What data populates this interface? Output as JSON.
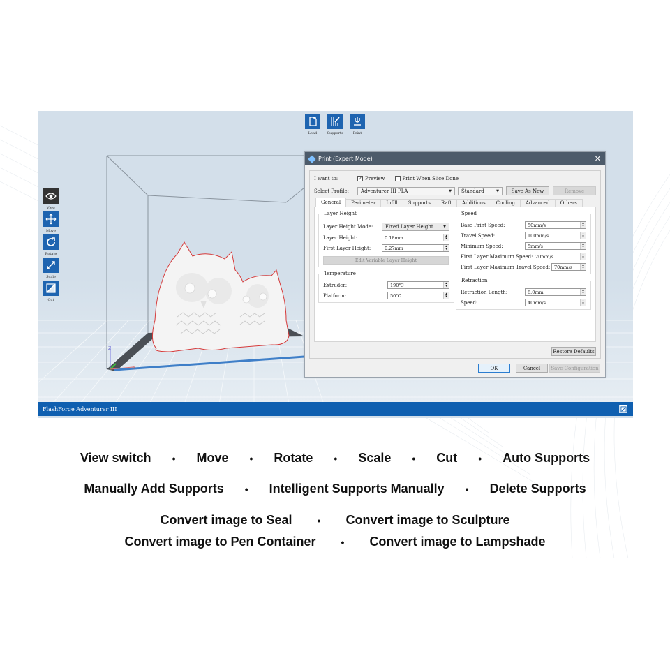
{
  "top_toolbar": [
    {
      "id": "load",
      "label": "Load",
      "icon": "file-add-icon"
    },
    {
      "id": "supports",
      "label": "Supports",
      "icon": "supports-icon"
    },
    {
      "id": "print",
      "label": "Print",
      "icon": "print-icon"
    }
  ],
  "left_toolbar": [
    {
      "id": "view",
      "label": "View",
      "icon": "eye-icon",
      "active": true
    },
    {
      "id": "move",
      "label": "Move",
      "icon": "move-arrows-icon"
    },
    {
      "id": "rotate",
      "label": "Rotate",
      "icon": "rotate-icon"
    },
    {
      "id": "scale",
      "label": "Scale",
      "icon": "scale-arrow-icon"
    },
    {
      "id": "cut",
      "label": "Cut",
      "icon": "cut-icon"
    }
  ],
  "viewport": {
    "axis_labels": {
      "z": "Z",
      "x": "X"
    }
  },
  "statusbar": {
    "text": "FlashForge Adventurer III"
  },
  "dialog": {
    "title": "Print (Expert Mode)",
    "i_want_to_label": "I want to:",
    "preview_label": "Preview",
    "preview_checked": true,
    "print_when_slice_done_label": "Print When Slice Done",
    "print_when_slice_done_checked": false,
    "select_profile_label": "Select Profile:",
    "profile_value": "Adventurer III PLA",
    "quality_value": "Standard",
    "save_as_new_label": "Save As New",
    "remove_label": "Remove",
    "tabs": [
      "General",
      "Perimeter",
      "Infill",
      "Supports",
      "Raft",
      "Additions",
      "Cooling",
      "Advanced",
      "Others"
    ],
    "active_tab": "General",
    "layer_height": {
      "title": "Layer Height",
      "mode_label": "Layer Height Mode:",
      "mode_value": "Fixed Layer Height",
      "layer_height_label": "Layer Height:",
      "layer_height_value": "0.18mm",
      "first_layer_height_label": "First Layer Height:",
      "first_layer_height_value": "0.27mm",
      "edit_variable_label": "Edit Variable Layer Height"
    },
    "temperature": {
      "title": "Temperature",
      "extruder_label": "Extruder:",
      "extruder_value": "190℃",
      "platform_label": "Platform:",
      "platform_value": "50℃"
    },
    "speed": {
      "title": "Speed",
      "base_print_label": "Base Print Speed:",
      "base_print_value": "50mm/s",
      "travel_label": "Travel Speed:",
      "travel_value": "100mm/s",
      "minimum_label": "Minimum Speed:",
      "minimum_value": "5mm/s",
      "first_layer_max_label": "First Layer Maximum Speed:",
      "first_layer_max_value": "20mm/s",
      "first_layer_max_travel_label": "First Layer Maximum Travel Speed:",
      "first_layer_max_travel_value": "70mm/s"
    },
    "retraction": {
      "title": "Retraction",
      "length_label": "Retraction Length:",
      "length_value": "8.0mm",
      "speed_label": "Speed:",
      "speed_value": "40mm/s"
    },
    "restore_defaults_label": "Restore Defaults",
    "ok_label": "OK",
    "cancel_label": "Cancel",
    "save_configuration_label": "Save Configuration"
  },
  "captions": {
    "line1": [
      "View switch",
      "Move",
      "Rotate",
      "Scale",
      "Cut",
      "Auto Supports"
    ],
    "line2": [
      "Manually Add Supports",
      "Intelligent Supports Manually",
      "Delete Supports"
    ],
    "line3": [
      "Convert image to Seal",
      "Convert image to Sculpture"
    ],
    "line4": [
      "Convert image to Pen Container",
      "Convert image to Lampshade"
    ],
    "separator": "•"
  },
  "colors": {
    "accent_blue": "#1e64b0",
    "statusbar_blue": "#0f5fb0",
    "dialog_title_bg": "#4d5b6a",
    "viewport_bg": "#d3dfea",
    "model_outline": "#d63a3a"
  }
}
